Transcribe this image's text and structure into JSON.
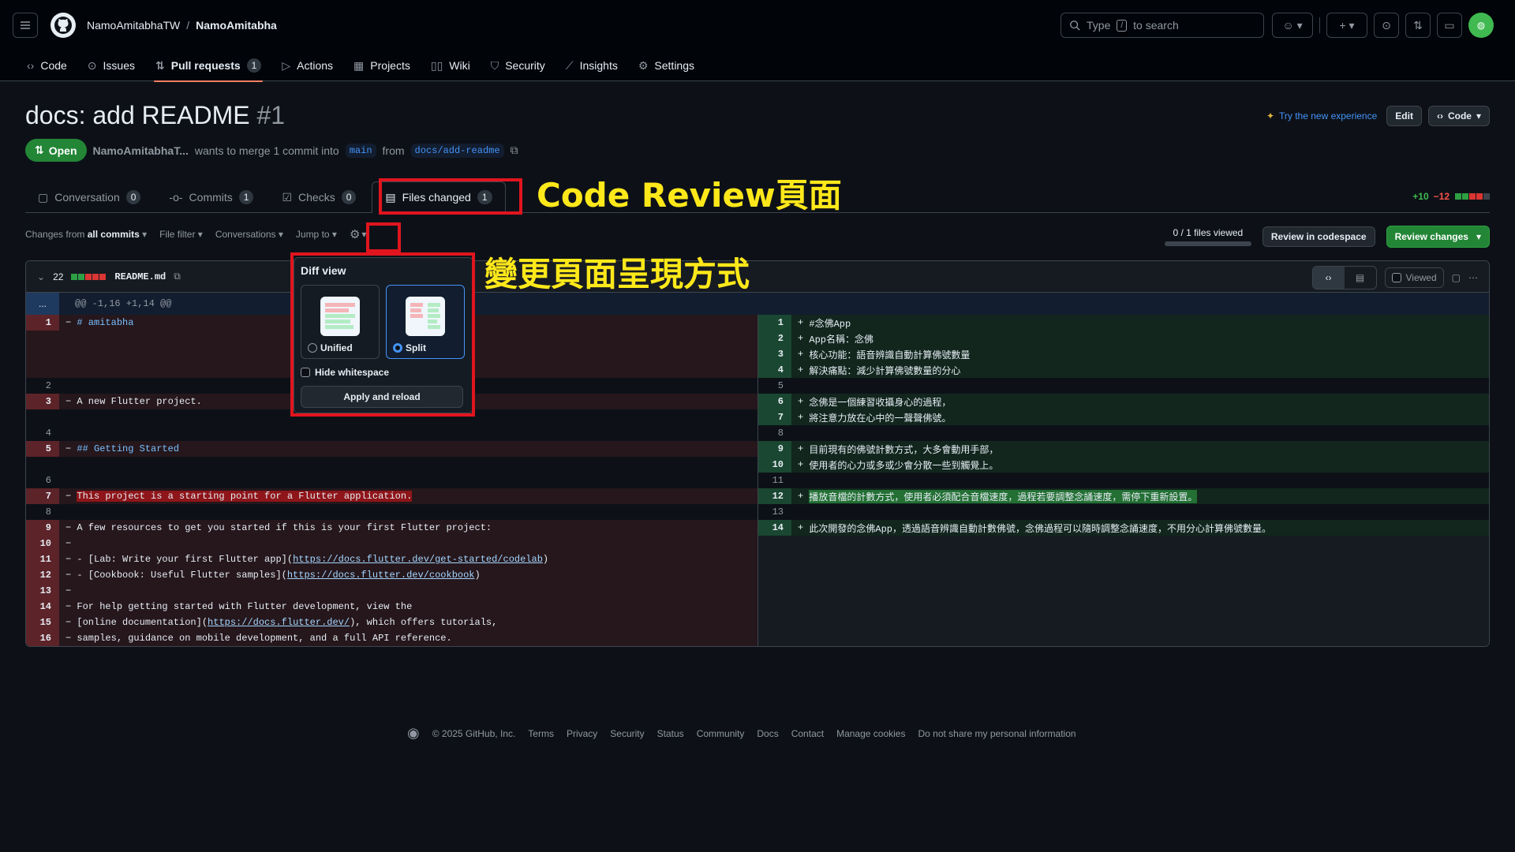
{
  "header": {
    "owner": "NamoAmitabhaTW",
    "separator": "/",
    "repo": "NamoAmitabha",
    "search_prefix": "Type",
    "search_key": "/",
    "search_suffix": "to search"
  },
  "nav": {
    "code": "Code",
    "issues": "Issues",
    "pull_requests": "Pull requests",
    "pull_requests_count": "1",
    "actions": "Actions",
    "projects": "Projects",
    "wiki": "Wiki",
    "security": "Security",
    "insights": "Insights",
    "settings": "Settings"
  },
  "pr": {
    "title": "docs: add README",
    "number": "#1",
    "state": "Open",
    "author": "NamoAmitabhaT...",
    "merge_text": "wants to merge 1 commit into",
    "base_branch": "main",
    "from_text": "from",
    "head_branch": "docs/add-readme",
    "try_new": "Try the new experience",
    "edit_label": "Edit",
    "code_label": "Code"
  },
  "tabs": {
    "conversation": "Conversation",
    "conversation_count": "0",
    "commits": "Commits",
    "commits_count": "1",
    "checks": "Checks",
    "checks_count": "0",
    "files_changed": "Files changed",
    "files_changed_count": "1"
  },
  "diffstat": {
    "additions": "+10",
    "deletions": "−12"
  },
  "toolbar": {
    "changes_from": "Changes from",
    "all_commits": "all commits",
    "file_filter": "File filter",
    "conversations": "Conversations",
    "jump_to": "Jump to",
    "files_viewed": "0 / 1 files viewed",
    "review_codespace": "Review in codespace",
    "review_changes": "Review changes"
  },
  "file": {
    "changes_count": "22",
    "name": "README.md",
    "viewed_label": "Viewed",
    "hunk_dots": "...",
    "hunk_header": "@@ -1,16 +1,14 @@"
  },
  "left_lines": [
    {
      "n": "1",
      "t": "del",
      "code": "# amitabha"
    },
    {
      "n": "2",
      "t": "ctx",
      "code": ""
    },
    {
      "n": "3",
      "t": "del",
      "code": "A new Flutter project."
    },
    {
      "n": "4",
      "t": "ctx",
      "code": ""
    },
    {
      "n": "5",
      "t": "del",
      "code": "## Getting Started"
    },
    {
      "n": "6",
      "t": "ctx",
      "code": ""
    },
    {
      "n": "7",
      "t": "del",
      "code": "This project is a starting point for a Flutter application."
    },
    {
      "n": "8",
      "t": "ctx",
      "code": ""
    },
    {
      "n": "9",
      "t": "del",
      "code": "A few resources to get you started if this is your first Flutter project:"
    },
    {
      "n": "10",
      "t": "del",
      "code": ""
    },
    {
      "n": "11",
      "t": "del",
      "code": "- [Lab: Write your first Flutter app](",
      "link": "https://docs.flutter.dev/get-started/codelab",
      "tail": ")"
    },
    {
      "n": "12",
      "t": "del",
      "code": "- [Cookbook: Useful Flutter samples](",
      "link": "https://docs.flutter.dev/cookbook",
      "tail": ")"
    },
    {
      "n": "13",
      "t": "del",
      "code": ""
    },
    {
      "n": "14",
      "t": "del",
      "code": "For help getting started with Flutter development, view the"
    },
    {
      "n": "15",
      "t": "del",
      "code": "[online documentation](",
      "link": "https://docs.flutter.dev/",
      "tail": "), which offers tutorials,"
    },
    {
      "n": "16",
      "t": "del",
      "code": "samples, guidance on mobile development, and a full API reference."
    }
  ],
  "right_lines": [
    {
      "n": "1",
      "t": "add",
      "code": "#念佛App"
    },
    {
      "n": "2",
      "t": "add",
      "code": "App名稱：念佛"
    },
    {
      "n": "3",
      "t": "add",
      "code": "核心功能：語音辨識自動計算佛號數量"
    },
    {
      "n": "4",
      "t": "add",
      "code": "解決痛點：減少計算佛號數量的分心"
    },
    {
      "n": "5",
      "t": "ctx",
      "code": ""
    },
    {
      "n": "6",
      "t": "add",
      "code": "念佛是一個練習收攝身心的過程，"
    },
    {
      "n": "7",
      "t": "add",
      "code": "將注意力放在心中的一聲聲佛號。"
    },
    {
      "n": "8",
      "t": "ctx",
      "code": ""
    },
    {
      "n": "9",
      "t": "add",
      "code": "目前現有的佛號計數方式，大多會動用手部，"
    },
    {
      "n": "10",
      "t": "add",
      "code": "使用者的心力或多或少會分散一些到觸覺上。"
    },
    {
      "n": "11",
      "t": "ctx",
      "code": ""
    },
    {
      "n": "12",
      "t": "add",
      "code": "播放音檔的計數方式，使用者必須配合音檔速度，過程若要調整念誦速度，需停下重新設置。"
    },
    {
      "n": "13",
      "t": "ctx",
      "code": ""
    },
    {
      "n": "14",
      "t": "add",
      "code": "此次開發的念佛App，透過語音辨識自動計數佛號，念佛過程可以隨時調整念誦速度，不用分心計算佛號數量。"
    }
  ],
  "popover": {
    "title": "Diff view",
    "unified": "Unified",
    "split": "Split",
    "hide_whitespace": "Hide whitespace",
    "apply": "Apply and reload"
  },
  "annotations": {
    "code_review": "Code Review頁面",
    "change_view": "變更頁面呈現方式"
  },
  "footer": {
    "copyright": "© 2025 GitHub, Inc.",
    "links": [
      "Terms",
      "Privacy",
      "Security",
      "Status",
      "Community",
      "Docs",
      "Contact",
      "Manage cookies",
      "Do not share my personal information"
    ]
  },
  "colors": {
    "accent_blue": "#4493f8",
    "open_green": "#238636",
    "annotation_red": "#e0151f",
    "annotation_yellow": "#ffe81a"
  }
}
